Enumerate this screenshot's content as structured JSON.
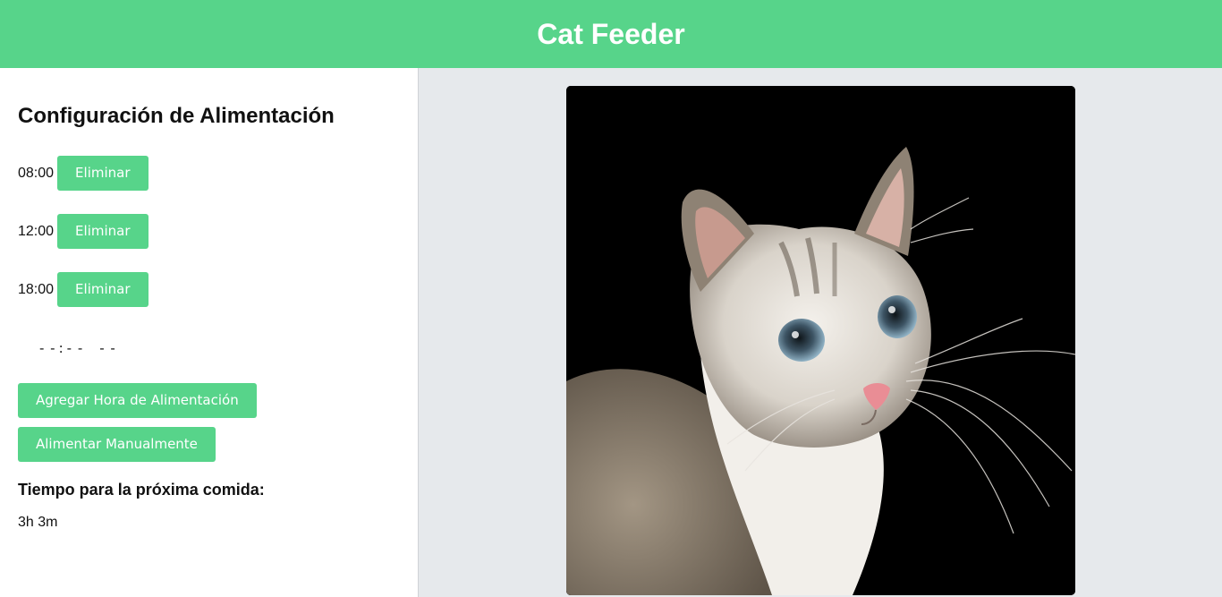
{
  "header": {
    "title": "Cat Feeder"
  },
  "config": {
    "title": "Configuración de Alimentación",
    "schedules": [
      {
        "time": "08:00",
        "delete_label": "Eliminar"
      },
      {
        "time": "12:00",
        "delete_label": "Eliminar"
      },
      {
        "time": "18:00",
        "delete_label": "Eliminar"
      }
    ],
    "time_input": {
      "hours": "- -",
      "separator": ":",
      "minutes": "- -",
      "ampm": "- -"
    },
    "add_button_label": "Agregar Hora de Alimentación",
    "manual_button_label": "Alimentar Manualmente",
    "next_meal_label": "Tiempo para la próxima comida:",
    "next_meal_value": "3h 3m"
  },
  "colors": {
    "accent": "#57d48a",
    "background": "#e6e9ec"
  },
  "image": {
    "subject": "cat-photo"
  }
}
